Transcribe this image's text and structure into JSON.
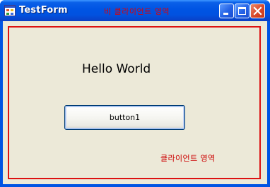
{
  "window": {
    "title": "TestForm",
    "nonclient_area_label": "비 클라이언트 영역",
    "caption_buttons": {
      "minimize_icon": "minimize-icon",
      "maximize_icon": "maximize-icon",
      "close_icon": "close-icon"
    },
    "colors": {
      "titlebar": "#0054e3",
      "client_background": "#ece9d8",
      "annotation_red": "#dd1111"
    }
  },
  "client": {
    "label": "Hello World",
    "button_label": "button1",
    "area_label": "클라이언트 영역"
  }
}
